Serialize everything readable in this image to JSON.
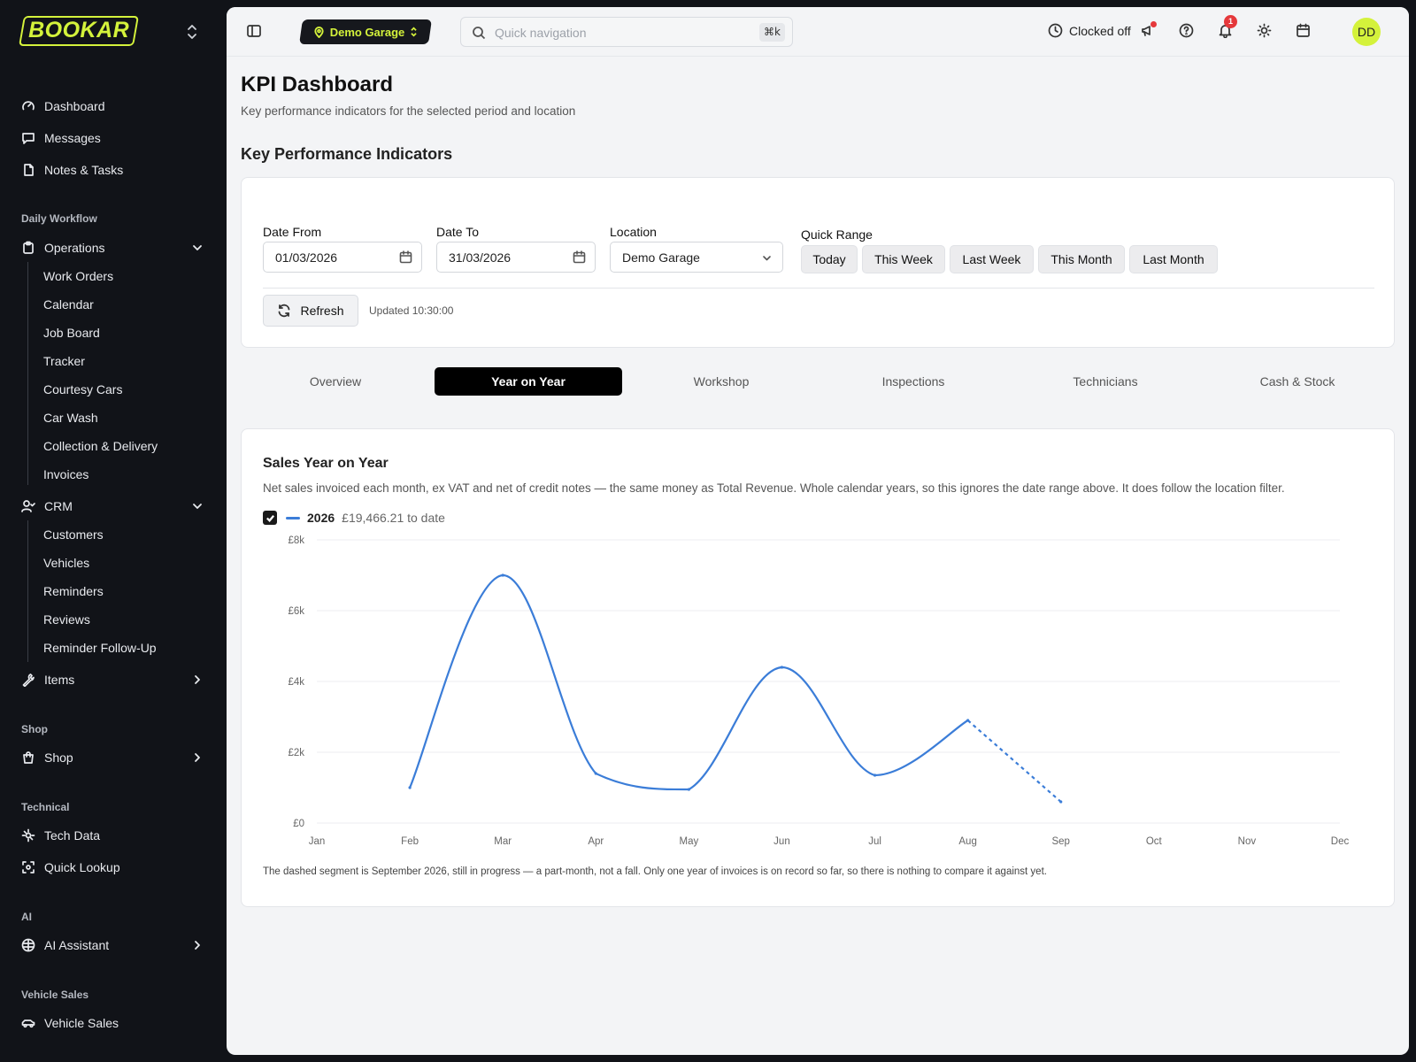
{
  "brand": {
    "logo_text": "BOOKAR",
    "accent": "#d4f23b"
  },
  "sidebar": {
    "top_items": [
      {
        "label": "Dashboard",
        "icon": "gauge-icon"
      },
      {
        "label": "Messages",
        "icon": "message-square-icon"
      },
      {
        "label": "Notes & Tasks",
        "icon": "file-icon"
      }
    ],
    "sections": {
      "daily_workflow": "Daily Workflow",
      "shop": "Shop",
      "technical": "Technical",
      "ai": "AI",
      "vehicle_sales": "Vehicle Sales"
    },
    "operations": {
      "label": "Operations",
      "children": [
        "Work Orders",
        "Calendar",
        "Job Board",
        "Tracker",
        "Courtesy Cars",
        "Car Wash",
        "Collection & Delivery",
        "Invoices"
      ]
    },
    "crm": {
      "label": "CRM",
      "children": [
        "Customers",
        "Vehicles",
        "Reminders",
        "Reviews",
        "Reminder Follow-Up"
      ]
    },
    "items": "Items",
    "shop_item": "Shop",
    "tech_data": "Tech Data",
    "quick_lookup": "Quick Lookup",
    "ai_assistant": "AI Assistant",
    "vehicle_sales_item": "Vehicle Sales"
  },
  "topbar": {
    "garage": "Demo Garage",
    "search_placeholder": "Quick navigation",
    "shortcut": "⌘k",
    "clock_status": "Clocked off",
    "notification_count": "1",
    "avatar_initials": "DD"
  },
  "page": {
    "title": "KPI Dashboard",
    "subtitle": "Key performance indicators for the selected period and location",
    "section_title": "Key Performance Indicators"
  },
  "filters": {
    "date_from_label": "Date From",
    "date_from": "01/03/2026",
    "date_to_label": "Date To",
    "date_to": "31/03/2026",
    "location_label": "Location",
    "location": "Demo Garage",
    "quick_range_label": "Quick Range",
    "quick_ranges": [
      "Today",
      "This Week",
      "Last Week",
      "This Month",
      "Last Month"
    ],
    "refresh_label": "Refresh",
    "updated": "Updated 10:30:00"
  },
  "tabs": [
    "Overview",
    "Year on Year",
    "Workshop",
    "Inspections",
    "Technicians",
    "Cash & Stock"
  ],
  "active_tab": "Year on Year",
  "chart_card": {
    "title": "Sales Year on Year",
    "description": "Net sales invoiced each month, ex VAT and net of credit notes — the same money as Total Revenue. Whole calendar years, so this ignores the date range above. It does follow the location filter.",
    "legend_year": "2026",
    "legend_amount": "£19,466.21 to date",
    "note": "The dashed segment is September 2026, still in progress — a part-month, not a fall. Only one year of invoices is on record so far, so there is nothing to compare it against yet."
  },
  "chart_data": {
    "type": "line",
    "categories": [
      "Jan",
      "Feb",
      "Mar",
      "Apr",
      "May",
      "Jun",
      "Jul",
      "Aug",
      "Sep",
      "Oct",
      "Nov",
      "Dec"
    ],
    "series": [
      {
        "name": "2026",
        "color": "#3b7dd8",
        "values": [
          null,
          1000,
          7000,
          1400,
          950,
          4400,
          1350,
          2900,
          600,
          null,
          null,
          null
        ],
        "dashed_from_index": 7
      }
    ],
    "ytick_labels": [
      "£0",
      "£2k",
      "£4k",
      "£6k",
      "£8k"
    ],
    "ylim": [
      0,
      8000
    ],
    "grid": true
  }
}
